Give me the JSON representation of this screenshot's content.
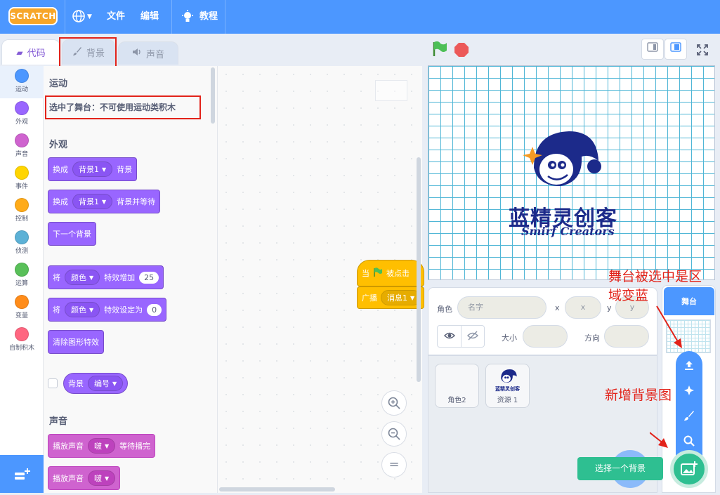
{
  "menubar": {
    "logo": "SCRATCH",
    "file": "文件",
    "edit": "编辑",
    "tutorials": "教程",
    "globe_icon": "globe-icon",
    "bulb_icon": "lightbulb-icon"
  },
  "tabs": {
    "code": "代码",
    "backdrops": "背景",
    "sounds": "声音"
  },
  "categories": [
    {
      "label": "运动",
      "color": "#4c97ff"
    },
    {
      "label": "外观",
      "color": "#9966ff"
    },
    {
      "label": "声音",
      "color": "#cf63cf"
    },
    {
      "label": "事件",
      "color": "#ffd500"
    },
    {
      "label": "控制",
      "color": "#ffab19"
    },
    {
      "label": "侦测",
      "color": "#5cb1d6"
    },
    {
      "label": "运算",
      "color": "#59c059"
    },
    {
      "label": "变量",
      "color": "#ff8c1a"
    },
    {
      "label": "自制积木",
      "color": "#ff6680"
    }
  ],
  "palette": {
    "motion_title": "运动",
    "motion_note": "选中了舞台：不可使用运动类积木",
    "looks_title": "外观",
    "switch_bd": {
      "a": "换成",
      "menu": "背景1",
      "b": "背景"
    },
    "switch_bd_wait": {
      "a": "换成",
      "menu": "背景1",
      "b": "背景并等待"
    },
    "next_bd": "下一个背景",
    "change_effect": {
      "a": "将",
      "menu": "颜色",
      "b": "特效增加",
      "val": "25"
    },
    "set_effect": {
      "a": "将",
      "menu": "颜色",
      "b": "特效设定为",
      "val": "0"
    },
    "clear_effects": "清除图形特效",
    "bd_reporter": {
      "a": "背景",
      "menu": "编号"
    },
    "sound_title": "声音",
    "play_until": {
      "a": "播放声音",
      "menu": "啵",
      "b": "等待播完"
    },
    "play": {
      "a": "播放声音",
      "menu": "啵"
    }
  },
  "workspace": {
    "hat_a": "当",
    "hat_b": "被点击",
    "broadcast": "广播",
    "broadcast_menu": "消息1",
    "zoom_in": "zoom-in-icon",
    "zoom_out": "zoom-out-icon",
    "zoom_reset": "="
  },
  "stage": {
    "logo_cn": "蓝精灵创客",
    "logo_en": "Smirf Creators"
  },
  "sprite_info": {
    "sprite_label": "角色",
    "name_placeholder": "名字",
    "x_label": "x",
    "x_placeholder": "x",
    "y_label": "y",
    "y_placeholder": "y",
    "size_label": "大小",
    "direction_label": "方向"
  },
  "sprites": [
    {
      "name": "角色2"
    },
    {
      "name": "资源 1",
      "thumb_text": "蓝精灵创客"
    }
  ],
  "stage_selector": {
    "title": "舞台",
    "tooltip": "选择一个背景"
  },
  "annotations": {
    "stage_selected_1": "舞台被选中是区",
    "stage_selected_2": "域变蓝",
    "new_backdrop": "新增背景图"
  }
}
